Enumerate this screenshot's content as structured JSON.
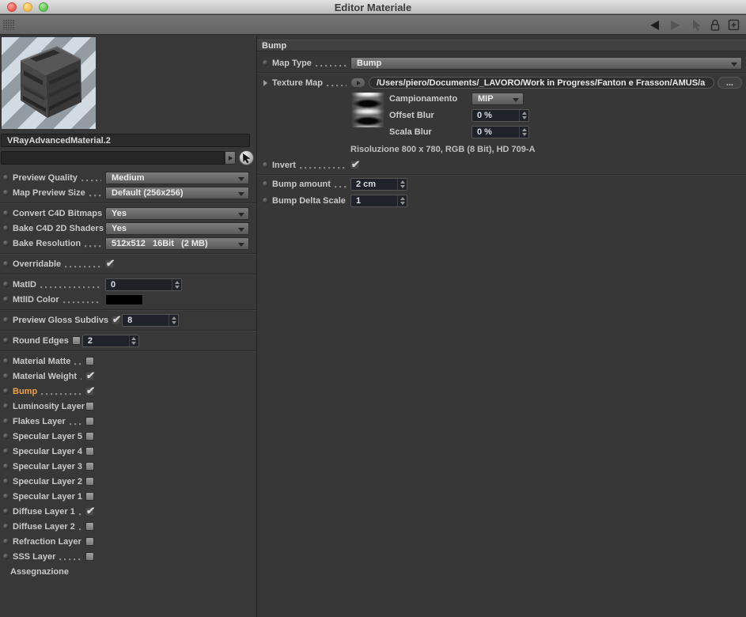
{
  "window": {
    "title": "Editor Materiale"
  },
  "colors": {
    "active_channel": "#f2a13c",
    "panel_bg": "#373737",
    "field_bg": "#1f2329"
  },
  "preview": {
    "material_name": "VRayAdvancedMaterial.2",
    "shader_link_value": ""
  },
  "left_panel": {
    "preview_quality": {
      "label": "Preview Quality",
      "value": "Medium"
    },
    "map_preview_size": {
      "label": "Map Preview Size",
      "value": "Default (256x256)"
    },
    "convert_bitmaps": {
      "label": "Convert C4D Bitmaps",
      "value": "Yes"
    },
    "bake_shaders": {
      "label": "Bake C4D 2D Shaders",
      "value": "Yes"
    },
    "bake_resolution": {
      "label": "Bake Resolution",
      "value": "512x512   16Bit   (2 MB)"
    },
    "overridable": {
      "label": "Overridable",
      "checked": true
    },
    "matid": {
      "label": "MatID",
      "value": "0"
    },
    "mtlid_color": {
      "label": "MtlID Color",
      "color": "#000000"
    },
    "preview_gloss": {
      "label": "Preview Gloss Subdivs",
      "checked": true,
      "value": "8"
    },
    "round_edges": {
      "label": "Round Edges",
      "checked": false,
      "value": "2"
    },
    "channels": [
      {
        "label": "Material Matte",
        "checked": false
      },
      {
        "label": "Material Weight",
        "checked": true
      },
      {
        "label": "Bump",
        "checked": true,
        "active": true
      },
      {
        "label": "Luminosity Layer",
        "checked": false
      },
      {
        "label": "Flakes Layer",
        "checked": false
      },
      {
        "label": "Specular Layer 5",
        "checked": false
      },
      {
        "label": "Specular Layer 4",
        "checked": false
      },
      {
        "label": "Specular Layer 3",
        "checked": false
      },
      {
        "label": "Specular Layer 2",
        "checked": false
      },
      {
        "label": "Specular Layer 1",
        "checked": false
      },
      {
        "label": "Diffuse Layer 1",
        "checked": true
      },
      {
        "label": "Diffuse Layer 2",
        "checked": false
      },
      {
        "label": "Refraction Layer",
        "checked": false
      },
      {
        "label": "SSS Layer",
        "checked": false
      }
    ],
    "assignment_label": "Assegnazione"
  },
  "right_panel": {
    "header": "Bump",
    "map_type": {
      "label": "Map Type",
      "value": "Bump"
    },
    "texture_map": {
      "label": "Texture Map",
      "path": "/Users/piero/Documents/_LAVORO/Work in Progress/Fanton e Frasson/AMUS/a",
      "browse": "..."
    },
    "campionamento": {
      "label": "Campionamento",
      "value": "MIP"
    },
    "offset_blur": {
      "label": "Offset Blur",
      "value": "0 %"
    },
    "scala_blur": {
      "label": "Scala Blur",
      "value": "0 %"
    },
    "resolution_info": "Risoluzione 800 x 780, RGB (8 Bit), HD 709-A",
    "invert": {
      "label": "Invert",
      "checked": true
    },
    "bump_amount": {
      "label": "Bump amount",
      "value": "2 cm"
    },
    "bump_delta_scale": {
      "label": "Bump Delta Scale",
      "value": "1"
    }
  }
}
